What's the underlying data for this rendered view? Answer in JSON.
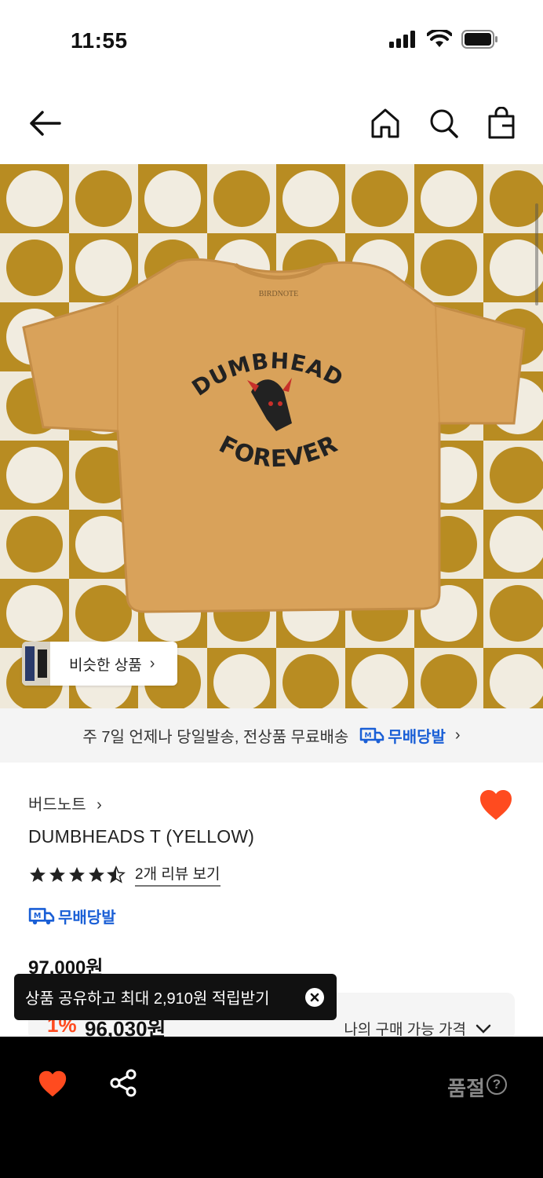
{
  "status_bar": {
    "time": "11:55"
  },
  "hero": {
    "similar_label": "비슷한 상품",
    "similar_chevron": "›"
  },
  "delivery": {
    "text": "주 7일 언제나 당일발송, 전상품 무료배송",
    "badge": "무배당발",
    "chevron": "›"
  },
  "product": {
    "brand": "버드노트",
    "brand_chevron": "›",
    "title": "DUMBHEADS T (YELLOW)",
    "rating": 4.5,
    "review_link": "2개 리뷰 보기",
    "badge": "무배당발",
    "original_price": "97,000원",
    "discount": "1%",
    "sale_price": "96,030원",
    "my_price_label": "나의 구매 가능 가격"
  },
  "toast": {
    "text": "상품 공유하고 최대 2,910원 적립받기"
  },
  "bottom_bar": {
    "status": "품절",
    "help": "?"
  },
  "shirt_print": {
    "line1": "DUMBHEADS",
    "line2": "FOREVER",
    "label": "BIRDNOTE"
  },
  "colors": {
    "accent_red": "#ff4b1f",
    "badge_blue": "#1a5fd6",
    "shirt": "#d9a25a",
    "rug_gold": "#b88c22"
  }
}
